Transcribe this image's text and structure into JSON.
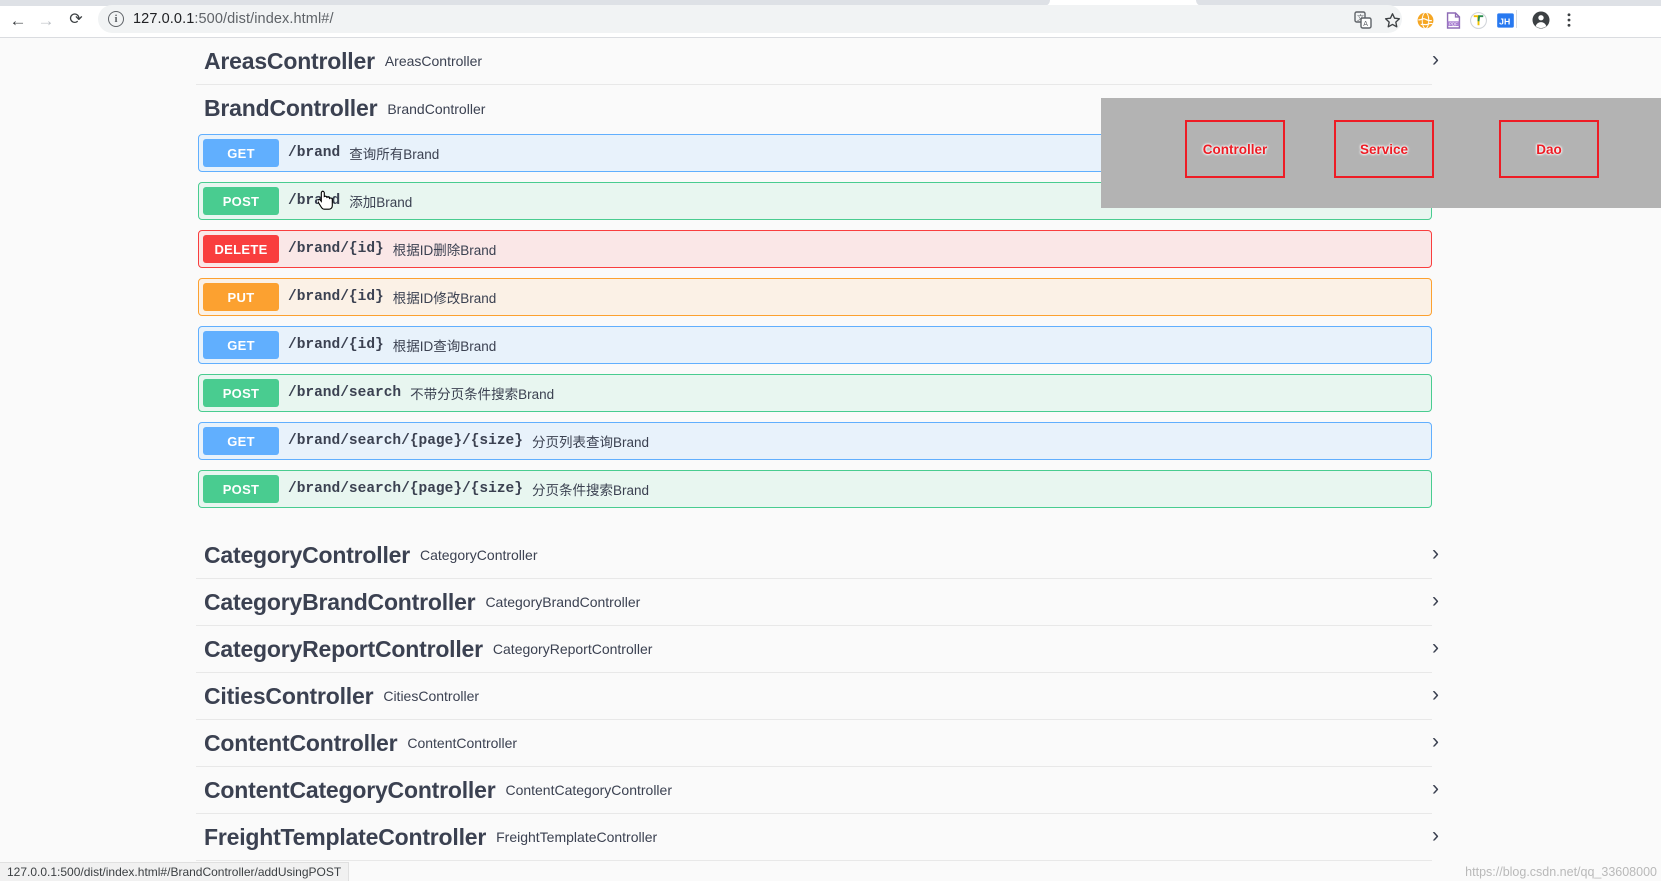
{
  "browser": {
    "back_icon": "arrow-left-icon",
    "forward_icon": "arrow-right-icon",
    "reload_icon": "reload-icon",
    "back_glyph": "←",
    "forward_glyph": "→",
    "reload_glyph": "⟳",
    "site_info_glyph": "i",
    "url_host": "127.0.0.1",
    "url_rest": ":500/dist/index.html#/",
    "url_full": "127.0.0.1:500/dist/index.html#/",
    "toolbar_icons": [
      {
        "name": "translate-icon",
        "glyph": "文"
      },
      {
        "name": "bookmark-star-icon",
        "glyph": "☆"
      },
      {
        "name": "extension-globe-icon",
        "glyph": "🌐"
      },
      {
        "name": "extension-pdf-icon",
        "glyph": "PDF"
      },
      {
        "name": "extension-funnel-icon",
        "glyph": "Y"
      },
      {
        "name": "extension-jh-icon",
        "glyph": "JH"
      },
      {
        "name": "profile-avatar-icon",
        "glyph": "◉"
      },
      {
        "name": "chrome-menu-icon",
        "glyph": "⋮"
      }
    ]
  },
  "status_bar": {
    "text": "127.0.0.1:500/dist/index.html#/BrandController/addUsingPOST"
  },
  "watermark": {
    "text": "https://blog.csdn.net/qq_33608000"
  },
  "annotation_overlay": {
    "boxes": [
      {
        "label": "Controller"
      },
      {
        "label": "Service"
      },
      {
        "label": "Dao"
      }
    ],
    "border_color": "#ee1c25",
    "text_color": "#ee1c25",
    "background": "#b3b3b3"
  },
  "swagger": {
    "chevron_right": "›",
    "chevron_down": "⌄",
    "tags": [
      {
        "name": "AreasController",
        "description": "AreasController",
        "expanded": false,
        "operations": []
      },
      {
        "name": "BrandController",
        "description": "BrandController",
        "expanded": true,
        "operations": [
          {
            "method": "GET",
            "path": "/brand",
            "summary": "查询所有Brand"
          },
          {
            "method": "POST",
            "path": "/brand",
            "summary": "添加Brand"
          },
          {
            "method": "DELETE",
            "path": "/brand/{id}",
            "summary": "根据ID删除Brand"
          },
          {
            "method": "PUT",
            "path": "/brand/{id}",
            "summary": "根据ID修改Brand"
          },
          {
            "method": "GET",
            "path": "/brand/{id}",
            "summary": "根据ID查询Brand"
          },
          {
            "method": "POST",
            "path": "/brand/search",
            "summary": "不带分页条件搜索Brand"
          },
          {
            "method": "GET",
            "path": "/brand/search/{page}/{size}",
            "summary": "分页列表查询Brand"
          },
          {
            "method": "POST",
            "path": "/brand/search/{page}/{size}",
            "summary": "分页条件搜索Brand"
          }
        ]
      },
      {
        "name": "CategoryController",
        "description": "CategoryController",
        "expanded": false,
        "operations": []
      },
      {
        "name": "CategoryBrandController",
        "description": "CategoryBrandController",
        "expanded": false,
        "operations": []
      },
      {
        "name": "CategoryReportController",
        "description": "CategoryReportController",
        "expanded": false,
        "operations": []
      },
      {
        "name": "CitiesController",
        "description": "CitiesController",
        "expanded": false,
        "operations": []
      },
      {
        "name": "ContentController",
        "description": "ContentController",
        "expanded": false,
        "operations": []
      },
      {
        "name": "ContentCategoryController",
        "description": "ContentCategoryController",
        "expanded": false,
        "operations": []
      },
      {
        "name": "FreightTemplateController",
        "description": "FreightTemplateController",
        "expanded": false,
        "operations": []
      }
    ]
  }
}
